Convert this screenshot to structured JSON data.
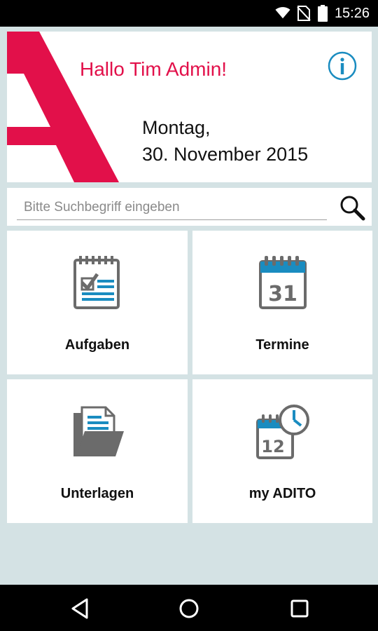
{
  "status_bar": {
    "time": "15:26",
    "icons": [
      "wifi-icon",
      "no-sim-icon",
      "battery-icon"
    ]
  },
  "header": {
    "greeting": "Hallo Tim Admin!",
    "date_line1": "Montag,",
    "date_line2": "30. November 2015",
    "info_icon": "info-icon",
    "accent_color": "#e2104a"
  },
  "search": {
    "placeholder": "Bitte Suchbegriff eingeben",
    "value": "",
    "icon": "search-icon"
  },
  "tiles": [
    {
      "label": "Aufgaben",
      "icon": "tasks-icon"
    },
    {
      "label": "Termine",
      "icon": "calendar-icon"
    },
    {
      "label": "Unterlagen",
      "icon": "documents-icon"
    },
    {
      "label": "my ADITO",
      "icon": "calendar-clock-icon"
    }
  ],
  "nav_bar": {
    "icons": [
      "back-icon",
      "home-icon",
      "recents-icon"
    ]
  },
  "colors": {
    "background": "#d4e2e4",
    "icon_gray": "#6b6b6b",
    "icon_blue": "#1a8cc0"
  }
}
